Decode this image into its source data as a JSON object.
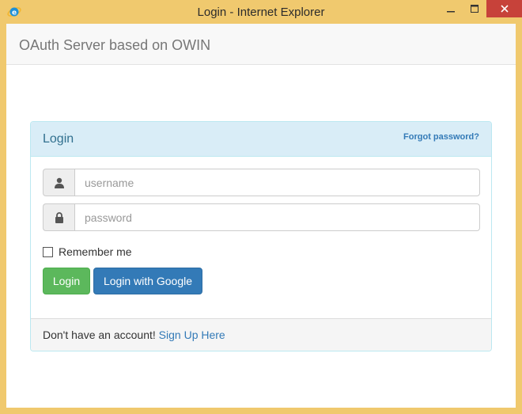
{
  "window": {
    "title": "Login - Internet Explorer",
    "controls": {
      "minimize": "—",
      "maximize": "☐",
      "close": "✕"
    },
    "frame_color": "#f0c96e",
    "close_color": "#c7423a"
  },
  "navbar": {
    "brand": "OAuth Server based on OWIN"
  },
  "panel": {
    "title": "Login",
    "forgot_password": "Forgot password?",
    "username_placeholder": "username",
    "password_placeholder": "password",
    "remember_me": "Remember me",
    "login_button": "Login",
    "google_button": "Login with Google",
    "footer_text": "Don't have an account! ",
    "signup_link": "Sign Up Here"
  },
  "icons": {
    "app": "internet-explorer-icon",
    "username": "user-icon",
    "password": "lock-icon"
  },
  "colors": {
    "panel_heading_bg": "#d9edf7",
    "panel_title": "#31708f",
    "link": "#337ab7",
    "success": "#5cb85c",
    "primary": "#337ab7"
  }
}
